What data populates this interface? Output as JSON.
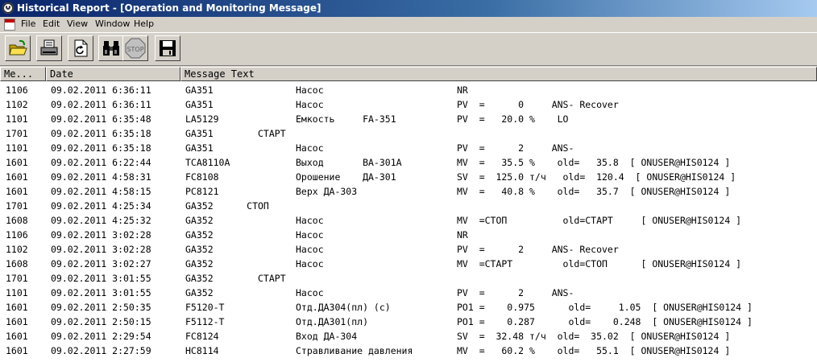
{
  "window": {
    "title": "Historical Report - [Operation and Monitoring Message]"
  },
  "menu": {
    "items": [
      "File",
      "Edit",
      "View",
      "Window",
      "Help"
    ]
  },
  "toolbar": {
    "buttons": [
      {
        "name": "open-icon"
      },
      {
        "name": "print-icon"
      },
      {
        "name": "refresh-icon"
      },
      {
        "name": "find-icon"
      },
      {
        "name": "stop-icon",
        "label": "STOP"
      },
      {
        "name": "save-icon"
      }
    ]
  },
  "table": {
    "columns": [
      "Me...",
      "Date",
      "Message Text"
    ],
    "rows": [
      {
        "id": "1106",
        "date": "09.02.2011 6:36:11",
        "tag": "GA351",
        "msg": "Насос",
        "data": "NR"
      },
      {
        "id": "1102",
        "date": "09.02.2011 6:36:11",
        "tag": "GA351",
        "msg": "Насос",
        "data": "PV  =      0     ANS- Recover"
      },
      {
        "id": "1101",
        "date": "09.02.2011 6:35:48",
        "tag": "LA5129",
        "msg": "Емкость     FA-351",
        "data": "PV  =   20.0 %    LO"
      },
      {
        "id": "1701",
        "date": "09.02.2011 6:35:18",
        "tag": "GA351        СТАРТ",
        "msg": "",
        "data": ""
      },
      {
        "id": "1101",
        "date": "09.02.2011 6:35:18",
        "tag": "GA351",
        "msg": "Насос",
        "data": "PV  =      2     ANS-"
      },
      {
        "id": "1601",
        "date": "09.02.2011 6:22:44",
        "tag": "TCA8110A",
        "msg": "Выход       BA-301A",
        "data": "MV  =   35.5 %    old=   35.8  [ ONUSER@HIS0124 ]"
      },
      {
        "id": "1601",
        "date": "09.02.2011 4:58:31",
        "tag": "FC8108",
        "msg": "Орошение    ДА-301",
        "data": "SV  =  125.0 т/ч   old=  120.4  [ ONUSER@HIS0124 ]"
      },
      {
        "id": "1601",
        "date": "09.02.2011 4:58:15",
        "tag": "PC8121",
        "msg": "Верх ДА-303",
        "data": "MV  =   40.8 %    old=   35.7  [ ONUSER@HIS0124 ]"
      },
      {
        "id": "1701",
        "date": "09.02.2011 4:25:34",
        "tag": "GA352      СТОП",
        "msg": "",
        "data": ""
      },
      {
        "id": "1608",
        "date": "09.02.2011 4:25:32",
        "tag": "GA352",
        "msg": "Насос",
        "data": "MV  =СТОП          old=СТАРТ     [ ONUSER@HIS0124 ]"
      },
      {
        "id": "1106",
        "date": "09.02.2011 3:02:28",
        "tag": "GA352",
        "msg": "Насос",
        "data": "NR"
      },
      {
        "id": "1102",
        "date": "09.02.2011 3:02:28",
        "tag": "GA352",
        "msg": "Насос",
        "data": "PV  =      2     ANS- Recover"
      },
      {
        "id": "1608",
        "date": "09.02.2011 3:02:27",
        "tag": "GA352",
        "msg": "Насос",
        "data": "MV  =СТАРТ         old=СТОП      [ ONUSER@HIS0124 ]"
      },
      {
        "id": "1701",
        "date": "09.02.2011 3:01:55",
        "tag": "GA352        СТАРТ",
        "msg": "",
        "data": ""
      },
      {
        "id": "1101",
        "date": "09.02.2011 3:01:55",
        "tag": "GA352",
        "msg": "Насос",
        "data": "PV  =      2     ANS-"
      },
      {
        "id": "1601",
        "date": "09.02.2011 2:50:35",
        "tag": "F5120-T",
        "msg": "Отд.ДА304(пл) (с)",
        "data": "PO1 =    0.975      old=     1.05  [ ONUSER@HIS0124 ]"
      },
      {
        "id": "1601",
        "date": "09.02.2011 2:50:15",
        "tag": "F5112-T",
        "msg": "Отд.ДА301(пл)",
        "data": "PO1 =    0.287      old=    0.248  [ ONUSER@HIS0124 ]"
      },
      {
        "id": "1601",
        "date": "09.02.2011 2:29:54",
        "tag": "FC8124",
        "msg": "Вход ДА-304",
        "data": "SV  =  32.48 т/ч  old=  35.02  [ ONUSER@HIS0124 ]"
      },
      {
        "id": "1601",
        "date": "09.02.2011 2:27:59",
        "tag": "HC8114",
        "msg": "Стравливание давления",
        "data": "MV  =   60.2 %    old=   55.1  [ ONUSER@HIS0124 ]"
      }
    ]
  }
}
